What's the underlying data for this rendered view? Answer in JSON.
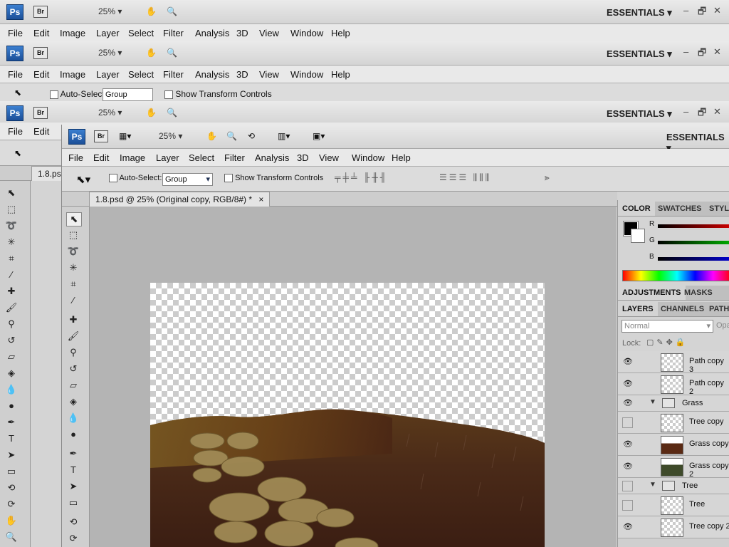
{
  "app": {
    "logo": "Ps",
    "bridge": "Br",
    "zoom": "25%",
    "workspace": "ESSENTIALS",
    "minimize": "–",
    "restore": "🗗",
    "close": "✕"
  },
  "menu": [
    "File",
    "Edit",
    "Image",
    "Layer",
    "Select",
    "Filter",
    "Analysis",
    "3D",
    "View",
    "Window",
    "Help"
  ],
  "options": {
    "auto_select_label": "Auto-Select:",
    "auto_select_value": "Group",
    "show_transform_label": "Show Transform Controls"
  },
  "back_window": {
    "doc_tab": "1.8.ps"
  },
  "document": {
    "tab_title": "1.8.psd @ 25% (Original copy, RGB/8#) *",
    "tab_close": "×"
  },
  "panels": {
    "color_tabs": [
      "COLOR",
      "SWATCHES",
      "STYLE"
    ],
    "color_channels": [
      {
        "label": "R",
        "color": "#cc0000"
      },
      {
        "label": "G",
        "color": "#00aa00"
      },
      {
        "label": "B",
        "color": "#0000cc"
      }
    ],
    "adjust_tabs": [
      "ADJUSTMENTS",
      "MASKS"
    ],
    "layer_tabs": [
      "LAYERS",
      "CHANNELS",
      "PATH"
    ],
    "blend_mode": "Normal",
    "opacity_label": "Opa",
    "lock_label": "Lock:"
  },
  "layers": [
    {
      "name": "Path copy 3",
      "visible": true,
      "type": "layer"
    },
    {
      "name": "Path copy 2",
      "visible": true,
      "type": "layer"
    },
    {
      "name": "Grass",
      "visible": true,
      "type": "group"
    },
    {
      "name": "Tree copy",
      "visible": false,
      "type": "layer"
    },
    {
      "name": "Grass copy",
      "visible": true,
      "type": "layer"
    },
    {
      "name": "Grass copy 2",
      "visible": true,
      "type": "layer"
    },
    {
      "name": "Tree",
      "visible": false,
      "type": "group"
    },
    {
      "name": "Tree",
      "visible": false,
      "type": "layer"
    },
    {
      "name": "Tree copy 2",
      "visible": true,
      "type": "layer"
    }
  ]
}
